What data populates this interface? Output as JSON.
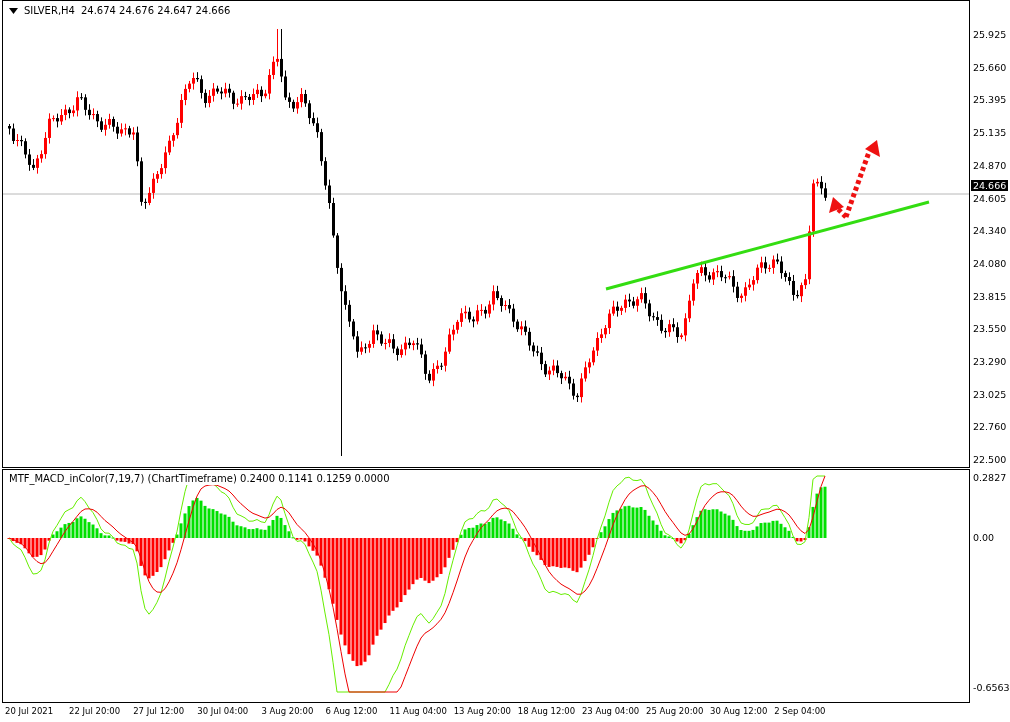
{
  "chart": {
    "symbol": "SILVER,H4",
    "quote": "24.674 24.676 24.647 24.666",
    "price_ticks": [
      "25.925",
      "25.660",
      "25.395",
      "25.135",
      "24.870",
      "24.605",
      "24.340",
      "24.080",
      "23.815",
      "23.550",
      "23.290",
      "23.025",
      "22.760",
      "22.500"
    ],
    "current_price": "24.666"
  },
  "indicator": {
    "label": "MTF_MACD_inColor(7,19,7) (ChartTimeframe) 0.2400 0.1141 0.1259 0.0000",
    "ticks": [
      "0.2827",
      "0.00",
      "-0.6563"
    ]
  },
  "time_axis": [
    "20 Jul 2021",
    "22 Jul 20:00",
    "27 Jul 12:00",
    "30 Jul 04:00",
    "3 Aug 20:00",
    "6 Aug 12:00",
    "11 Aug 04:00",
    "13 Aug 20:00",
    "18 Aug 12:00",
    "23 Aug 04:00",
    "25 Aug 20:00",
    "30 Aug 12:00",
    "2 Sep 04:00"
  ]
}
